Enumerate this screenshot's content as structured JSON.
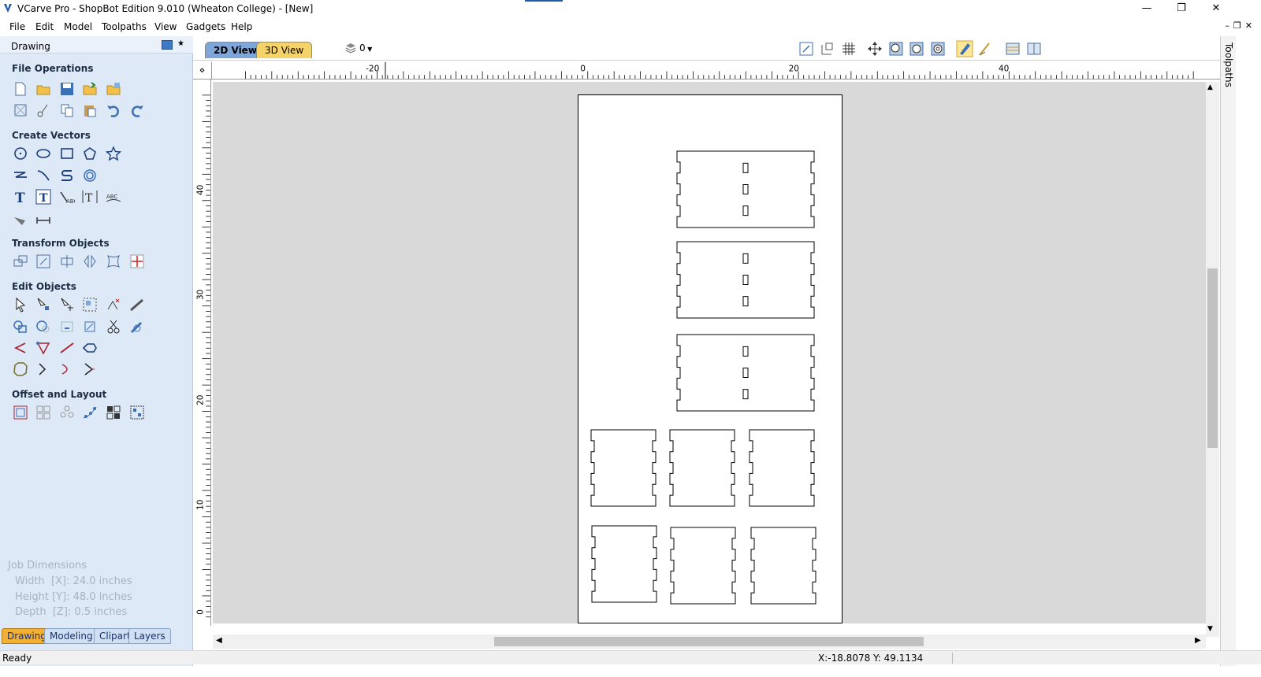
{
  "window": {
    "title": "VCarve Pro - ShopBot Edition 9.010 (Wheaton College) - [New]"
  },
  "menu": [
    "File",
    "Edit",
    "Model",
    "Toolpaths",
    "View",
    "Gadgets",
    "Help"
  ],
  "panel": {
    "title": "Drawing"
  },
  "sections": {
    "file": "File Operations",
    "create": "Create Vectors",
    "transform": "Transform Objects",
    "edit": "Edit Objects",
    "offset": "Offset and Layout"
  },
  "job": {
    "title": "Job Dimensions",
    "width": "Width  [X]: 24.0 inches",
    "height": "Height [Y]: 48.0 inches",
    "depth": "Depth  [Z]: 0.5 inches"
  },
  "bottom_tabs": [
    "Drawing",
    "Modeling",
    "Clipart",
    "Layers"
  ],
  "view_tabs": [
    "2D View",
    "3D View"
  ],
  "layer_selector": "0",
  "ruler": {
    "h_labels": [
      "-20",
      "0",
      "20",
      "40"
    ],
    "v_labels": [
      "40",
      "30",
      "20",
      "10",
      "0"
    ]
  },
  "right_dock": "Toolpaths",
  "status": {
    "left": "Ready",
    "coords": "X:-18.8078 Y: 49.1134"
  },
  "colors": {
    "panel_bg": "#dde9f7",
    "active_tab": "#f2b134",
    "canvas_bg": "#d9d9d9"
  }
}
